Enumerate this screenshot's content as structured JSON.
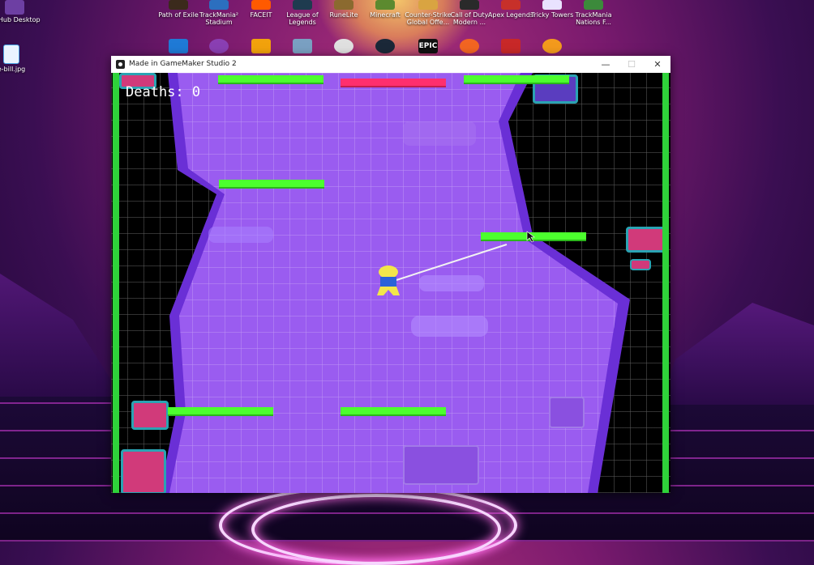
{
  "desktop": {
    "icons": [
      {
        "label": "GitHub Desktop",
        "color": "#6d3fa3"
      },
      {
        "label": "e-bill.jpg",
        "color": "#4aa6e8"
      },
      {
        "label": "Path of Exile",
        "color": "#3b2a1c"
      },
      {
        "label": "TrackMania² Stadium",
        "color": "#2c6fbf"
      },
      {
        "label": "FACEIT",
        "color": "#ff5a00"
      },
      {
        "label": "League of Legends",
        "color": "#1e3b4f"
      },
      {
        "label": "RuneLite",
        "color": "#8b6a2f"
      },
      {
        "label": "Minecraft",
        "color": "#5c8a2f"
      },
      {
        "label": "Counter-Strike Global Offe...",
        "color": "#d9a441"
      },
      {
        "label": "Call of Duty Modern ...",
        "color": "#2a2a2a"
      },
      {
        "label": "Apex Legends",
        "color": "#c7302a"
      },
      {
        "label": "Tricky Towers",
        "color": "#e9e2ff"
      },
      {
        "label": "TrackMania Nations F...",
        "color": "#3c8a3b"
      }
    ],
    "second_row_icons": [
      {
        "name": "windows-app-icon",
        "color": "#1f7ad6"
      },
      {
        "name": "gog-icon",
        "color": "#8a3fb3"
      },
      {
        "name": "rockstar-icon",
        "color": "#f2a20c"
      },
      {
        "name": "game-shortcut-icon",
        "color": "#7aa0c2"
      },
      {
        "name": "ubisoft-icon",
        "color": "#e0e0e0"
      },
      {
        "name": "steam-icon",
        "color": "#1b2838"
      },
      {
        "name": "epic-games-icon",
        "color": "#111111"
      },
      {
        "name": "origin-icon",
        "color": "#f26522"
      },
      {
        "name": "game-launcher-icon",
        "color": "#c82828"
      },
      {
        "name": "overwatch-icon",
        "color": "#f39a1d"
      }
    ],
    "epic_label": "EPIC"
  },
  "window": {
    "title": "Made in GameMaker Studio 2",
    "minimize": "—",
    "maximize": "☐",
    "close": "✕"
  },
  "game": {
    "hud_text": "Deaths: 0",
    "colors": {
      "platform": "#4cff2e",
      "hazard": "#ff2f6e",
      "wall": "#2fd23a",
      "purple_zone": "#9a5cf0",
      "purple_edge": "#6a2fd6",
      "player": "#f2e64a"
    }
  }
}
